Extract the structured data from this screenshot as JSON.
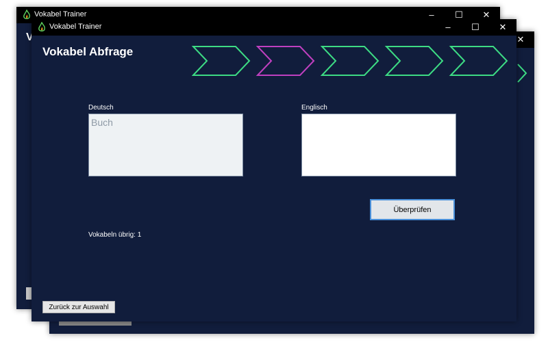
{
  "window": {
    "title": "Vokabel Trainer",
    "controls": {
      "minimize": "–",
      "maximize": "☐",
      "close": "✕"
    }
  },
  "page": {
    "title": "Vokabel Abfrage"
  },
  "ghost": {
    "letter": "V"
  },
  "progress": {
    "steps": [
      {
        "state": "done",
        "color": "#3ddc84"
      },
      {
        "state": "current",
        "color": "#c040c0"
      },
      {
        "state": "pending",
        "color": "#3ddc84"
      },
      {
        "state": "pending",
        "color": "#3ddc84"
      },
      {
        "state": "pending",
        "color": "#3ddc84"
      }
    ]
  },
  "form": {
    "deutsch_label": "Deutsch",
    "deutsch_value": "Buch",
    "englisch_label": "Englisch",
    "englisch_value": "",
    "check_button": "Überprüfen"
  },
  "status": {
    "remaining": "Vokabeln übrig: 1"
  },
  "footer": {
    "back_button": "Zurück zur Auswahl"
  },
  "colors": {
    "window_bg": "#111d3c",
    "titlebar_bg": "#000000",
    "step_green": "#3ddc84",
    "step_magenta": "#c040c0",
    "button_focus_border": "#4a90d9"
  }
}
